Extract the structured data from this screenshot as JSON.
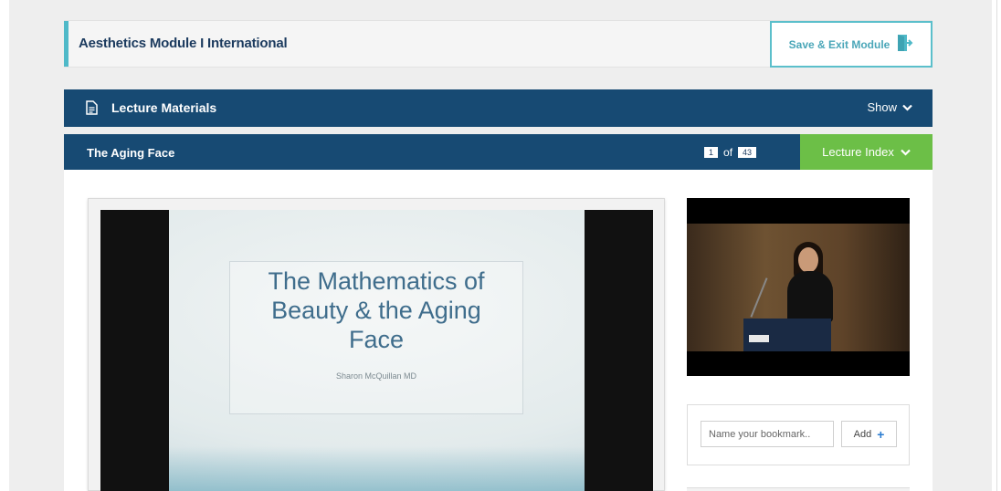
{
  "module": {
    "title": "Aesthetics Module I International",
    "save_exit_label": "Save & Exit Module"
  },
  "materials": {
    "label": "Lecture Materials",
    "toggle_label": "Show"
  },
  "lecture": {
    "title": "The Aging Face",
    "current_slide": "1",
    "of_label": "of",
    "total_slides": "43",
    "index_label": "Lecture Index"
  },
  "slide": {
    "title_line1": "The Mathematics of",
    "title_line2": "Beauty & the Aging",
    "title_line3": "Face",
    "author": "Sharon McQuillan MD"
  },
  "bookmark": {
    "placeholder": "Name your bookmark..",
    "add_label": "Add"
  },
  "icons": {
    "exit": "exit-door-icon",
    "document": "document-icon",
    "chevron": "chevron-down-icon",
    "plus": "plus-icon"
  },
  "colors": {
    "header_bar": "#174a73",
    "accent_teal": "#5bbfcb",
    "lecture_index_green": "#6cbf47",
    "plus_blue": "#2a7bd0"
  }
}
